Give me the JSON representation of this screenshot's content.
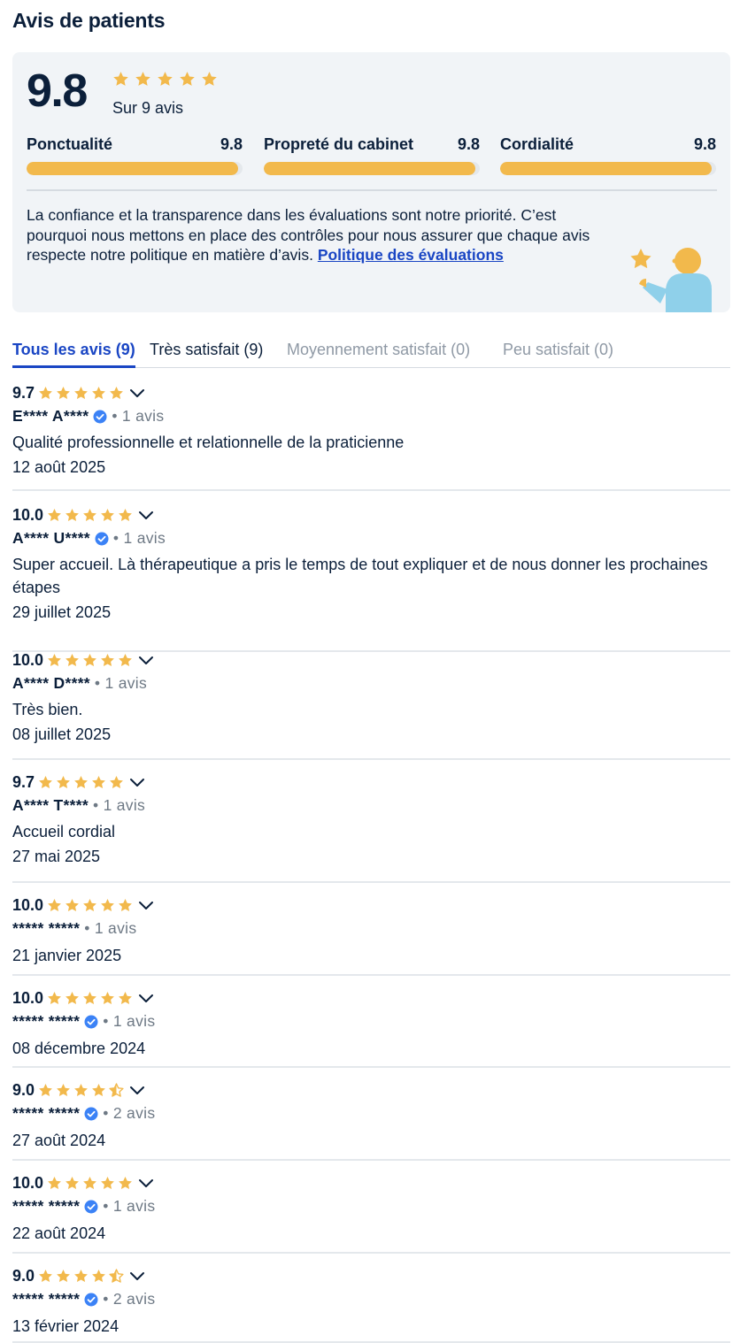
{
  "page_title": "Avis de patients",
  "summary": {
    "score": "9.8",
    "stars": 5,
    "count_text": "Sur 9 avis",
    "metrics": [
      {
        "label": "Ponctualité",
        "value": "9.8",
        "fill": 0.98
      },
      {
        "label": "Propreté du cabinet",
        "value": "9.8",
        "fill": 0.98
      },
      {
        "label": "Cordialité",
        "value": "9.8",
        "fill": 0.98
      }
    ],
    "trust_text": "La confiance et la transparence dans les évaluations sont notre priorité. C’est pourquoi nous mettons en place des contrôles pour nous assurer que chaque avis respecte notre politique en matière d’avis.",
    "trust_link": "Politique des évaluations"
  },
  "tabs": [
    {
      "label": "Tous les avis (9)",
      "state": "active"
    },
    {
      "label": "Très satisfait (9)",
      "state": "enabled"
    },
    {
      "label": "Moyennement satisfait (0)",
      "state": "disabled"
    },
    {
      "label": "Peu satisfait (0)",
      "state": "disabled"
    }
  ],
  "reviews": [
    {
      "score": "9.7",
      "stars": 5,
      "author": "E**** A****",
      "verified": true,
      "count": "• 1 avis",
      "comment": "Qualité professionnelle et relationnelle de la praticienne",
      "date": "12 août 2025"
    },
    {
      "score": "10.0",
      "stars": 5,
      "author": "A**** U****",
      "verified": true,
      "count": "• 1 avis",
      "comment": "Super accueil. Là thérapeutique a pris le temps de tout expliquer et de nous donner les prochaines étapes",
      "date": "29 juillet 2025"
    },
    {
      "score": "10.0",
      "stars": 5,
      "author": "A**** D****",
      "verified": false,
      "count": "• 1 avis",
      "comment": "Très bien.",
      "date": "08 juillet 2025"
    },
    {
      "score": "9.7",
      "stars": 5,
      "author": "A**** T****",
      "verified": false,
      "count": "• 1 avis",
      "comment": "Accueil cordial",
      "date": "27 mai 2025"
    },
    {
      "score": "10.0",
      "stars": 5,
      "author": "***** *****",
      "verified": false,
      "count": "• 1 avis",
      "comment": "",
      "date": "21 janvier 2025"
    },
    {
      "score": "10.0",
      "stars": 5,
      "author": "***** *****",
      "verified": true,
      "count": "• 1 avis",
      "comment": "",
      "date": "08 décembre 2024"
    },
    {
      "score": "9.0",
      "stars": 4.5,
      "author": "***** *****",
      "verified": true,
      "count": "• 2 avis",
      "comment": "",
      "date": "27 août 2024"
    },
    {
      "score": "10.0",
      "stars": 5,
      "author": "***** *****",
      "verified": true,
      "count": "• 1 avis",
      "comment": "",
      "date": "22 août 2024"
    },
    {
      "score": "9.0",
      "stars": 4.5,
      "author": "***** *****",
      "verified": true,
      "count": "• 2 avis",
      "comment": "",
      "date": "13 février 2024"
    }
  ],
  "colors": {
    "accent": "#1a46c4",
    "star": "#f2b94c",
    "verified": "#3b82f6",
    "text": "#0b1f3a"
  }
}
